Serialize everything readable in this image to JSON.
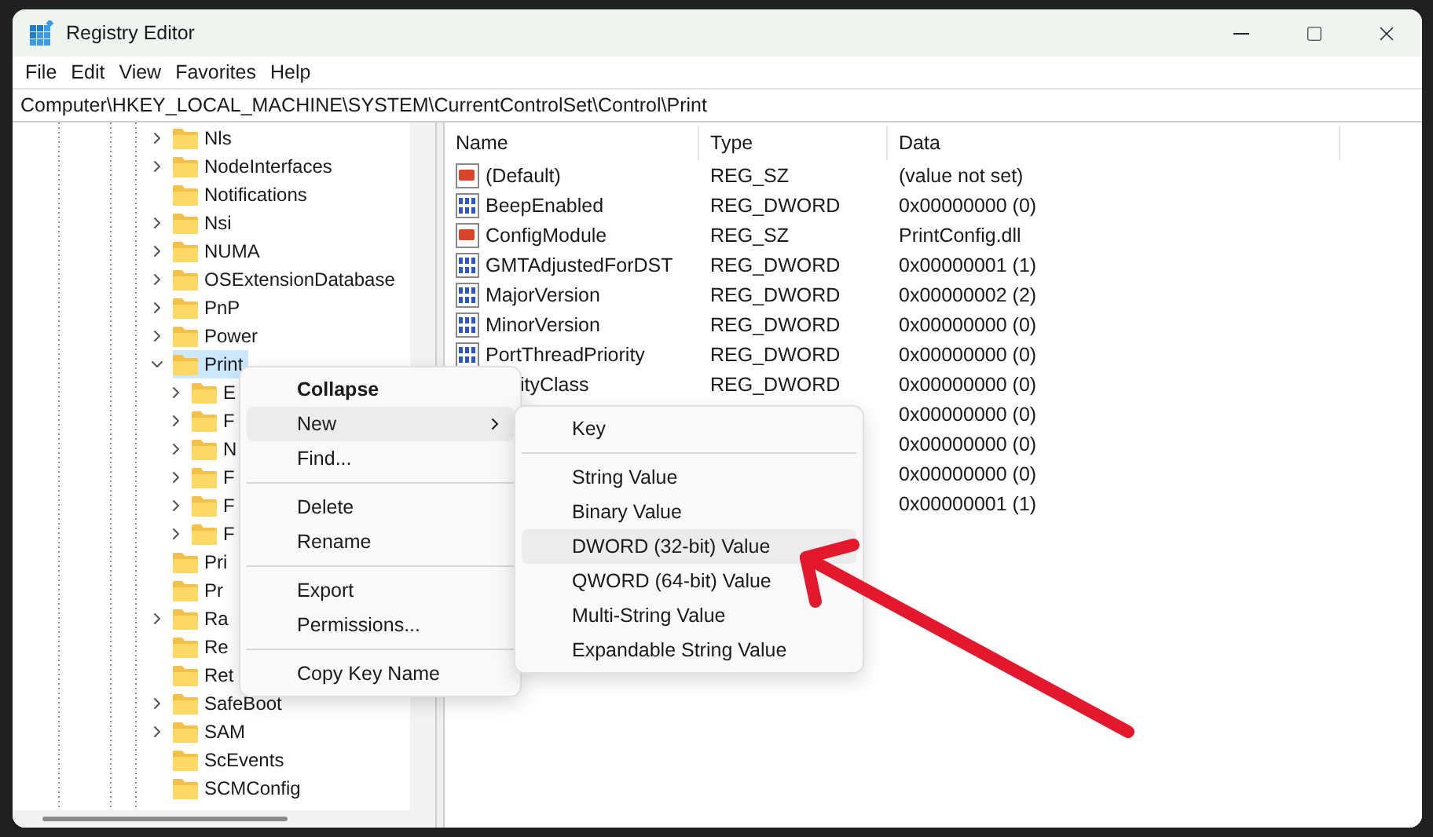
{
  "window": {
    "title": "Registry Editor"
  },
  "menu_bar": [
    "File",
    "Edit",
    "View",
    "Favorites",
    "Help"
  ],
  "address": "Computer\\HKEY_LOCAL_MACHINE\\SYSTEM\\CurrentControlSet\\Control\\Print",
  "tree": [
    {
      "label": "Nls",
      "expanded": false,
      "selected": false
    },
    {
      "label": "NodeInterfaces",
      "expanded": false,
      "selected": false
    },
    {
      "label": "Notifications",
      "selected": false
    },
    {
      "label": "Nsi",
      "expanded": false,
      "selected": false
    },
    {
      "label": "NUMA",
      "expanded": false,
      "selected": false
    },
    {
      "label": "OSExtensionDatabase",
      "expanded": false,
      "selected": false
    },
    {
      "label": "PnP",
      "expanded": false,
      "selected": false
    },
    {
      "label": "Power",
      "expanded": false,
      "selected": false
    },
    {
      "label": "Print",
      "expanded": true,
      "selected": true,
      "children": [
        {
          "label": "E",
          "expanded": false,
          "selected": false
        },
        {
          "label": "F",
          "expanded": false,
          "selected": false
        },
        {
          "label": "N",
          "expanded": false,
          "selected": false
        },
        {
          "label": "F",
          "expanded": false,
          "selected": false
        },
        {
          "label": "F",
          "expanded": false,
          "selected": false
        },
        {
          "label": "F",
          "expanded": false,
          "selected": false
        }
      ]
    },
    {
      "label": "Pri",
      "selected": false
    },
    {
      "label": "Pr",
      "selected": false
    },
    {
      "label": "Ra",
      "expanded": false,
      "selected": false
    },
    {
      "label": "Re",
      "selected": false
    },
    {
      "label": "Ret",
      "selected": false
    },
    {
      "label": "SafeBoot",
      "expanded": false,
      "selected": false
    },
    {
      "label": "SAM",
      "expanded": false,
      "selected": false
    },
    {
      "label": "ScEvents",
      "selected": false
    },
    {
      "label": "SCMConfig",
      "selected": false
    }
  ],
  "values": {
    "columns": [
      "Name",
      "Type",
      "Data"
    ],
    "rows": [
      {
        "kind": "string",
        "name": "(Default)",
        "type": "REG_SZ",
        "data": "(value not set)"
      },
      {
        "kind": "binary",
        "name": "BeepEnabled",
        "type": "REG_DWORD",
        "data": "0x00000000 (0)"
      },
      {
        "kind": "string",
        "name": "ConfigModule",
        "type": "REG_SZ",
        "data": "PrintConfig.dll"
      },
      {
        "kind": "binary",
        "name": "GMTAdjustedForDST",
        "type": "REG_DWORD",
        "data": "0x00000001 (1)"
      },
      {
        "kind": "binary",
        "name": "MajorVersion",
        "type": "REG_DWORD",
        "data": "0x00000002 (2)"
      },
      {
        "kind": "binary",
        "name": "MinorVersion",
        "type": "REG_DWORD",
        "data": "0x00000000 (0)"
      },
      {
        "kind": "binary",
        "name": "PortThreadPriority",
        "type": "REG_DWORD",
        "data": "0x00000000 (0)"
      },
      {
        "name": "ityClass",
        "type": "REG_DWORD",
        "data": "0x00000000 (0)"
      },
      {
        "data": "0x00000000 (0)"
      },
      {
        "data": "0x00000000 (0)"
      },
      {
        "data": "0x00000000 (0)"
      },
      {
        "data": "0x00000001 (1)"
      }
    ]
  },
  "context_menu": [
    {
      "kind": "item",
      "label": "Collapse",
      "bold": true,
      "selected": false
    },
    {
      "kind": "item",
      "label": "New",
      "submenu": true,
      "selected": true
    },
    {
      "kind": "item",
      "label": "Find...",
      "selected": false
    },
    {
      "kind": "separator"
    },
    {
      "kind": "item",
      "label": "Delete",
      "selected": false
    },
    {
      "kind": "item",
      "label": "Rename",
      "selected": false
    },
    {
      "kind": "separator"
    },
    {
      "kind": "item",
      "label": "Export",
      "selected": false
    },
    {
      "kind": "item",
      "label": "Permissions...",
      "selected": false
    },
    {
      "kind": "separator"
    },
    {
      "kind": "item",
      "label": "Copy Key Name",
      "selected": false
    }
  ],
  "submenu": [
    {
      "kind": "item",
      "label": "Key",
      "selected": false
    },
    {
      "kind": "separator"
    },
    {
      "kind": "item",
      "label": "String Value",
      "selected": false
    },
    {
      "kind": "item",
      "label": "Binary Value",
      "selected": false
    },
    {
      "kind": "item",
      "label": "DWORD (32-bit) Value",
      "selected": true
    },
    {
      "kind": "item",
      "label": "QWORD (64-bit) Value",
      "selected": false
    },
    {
      "kind": "item",
      "label": "Multi-String Value",
      "selected": false
    },
    {
      "kind": "item",
      "label": "Expandable String Value",
      "selected": false
    }
  ]
}
